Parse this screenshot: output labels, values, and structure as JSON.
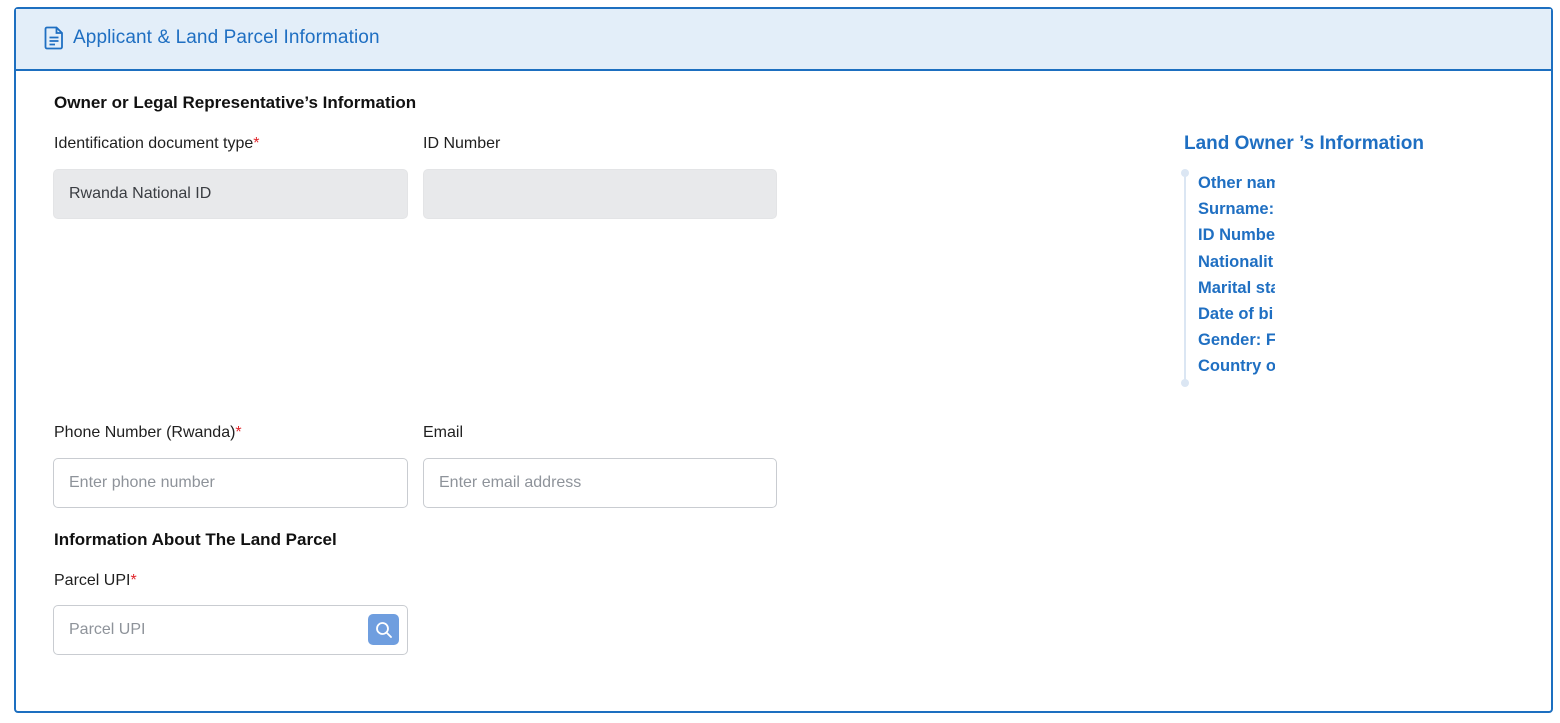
{
  "header": {
    "title": "Applicant & Land Parcel Information",
    "icon": "document-icon"
  },
  "owner_section": {
    "title": "Owner or Legal Representative’s Information",
    "id_type_label": "Identification document type",
    "id_type_value": "Rwanda National ID",
    "id_number_label": "ID Number",
    "id_number_value": "",
    "phone_label": "Phone Number (Rwanda)",
    "phone_placeholder": "Enter phone number",
    "email_label": "Email",
    "email_placeholder": "Enter email address"
  },
  "parcel_section": {
    "title": "Information About The Land Parcel",
    "upi_label": "Parcel UPI",
    "upi_placeholder": "Parcel UPI",
    "search_icon": "search-icon"
  },
  "required_marker": "*",
  "land_owner_info": {
    "title": "Land Owner ’s Information",
    "items": [
      "Other nam",
      "Surname:",
      "ID Numbe",
      "Nationalit",
      "Marital sta",
      "Date of bi",
      "Gender:  F",
      "Country o"
    ]
  },
  "colors": {
    "accent": "#1d6fc0",
    "header_bg": "#e3eef9",
    "required": "#e0242a",
    "search_button": "#6f9edf"
  }
}
